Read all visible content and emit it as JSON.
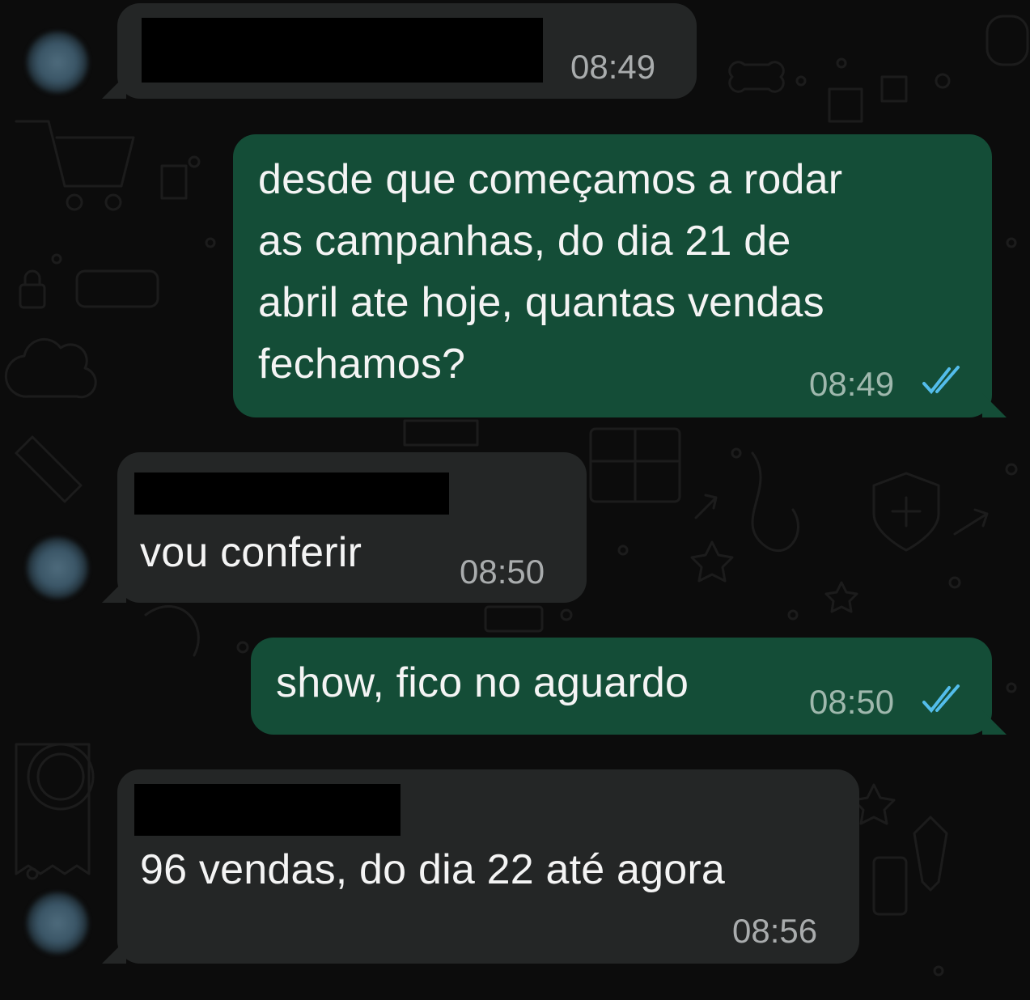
{
  "chat": {
    "messages": [
      {
        "direction": "incoming",
        "sender_name_redacted": true,
        "text": "",
        "time": "08:49"
      },
      {
        "direction": "outgoing",
        "text_lines": [
          "desde que começamos a rodar",
          "as campanhas, do dia 21 de",
          "abril ate hoje, quantas vendas",
          "fechamos?"
        ],
        "time": "08:49",
        "status": "read"
      },
      {
        "direction": "incoming",
        "sender_name_redacted": true,
        "text": "vou conferir",
        "time": "08:50"
      },
      {
        "direction": "outgoing",
        "text": "show, fico no aguardo",
        "time": "08:50",
        "status": "read"
      },
      {
        "direction": "incoming",
        "sender_name_redacted": true,
        "text": "96 vendas, do dia 22 até agora",
        "time": "08:56"
      }
    ]
  },
  "colors": {
    "background": "#0c0c0c",
    "incoming_bubble": "#242626",
    "outgoing_bubble": "#144d37",
    "read_ticks": "#53bdeb",
    "text": "#f4f4f4",
    "timestamp": "#a9acad"
  },
  "icons": [
    "double-check-icon",
    "avatar",
    "wallpaper-doodles"
  ]
}
